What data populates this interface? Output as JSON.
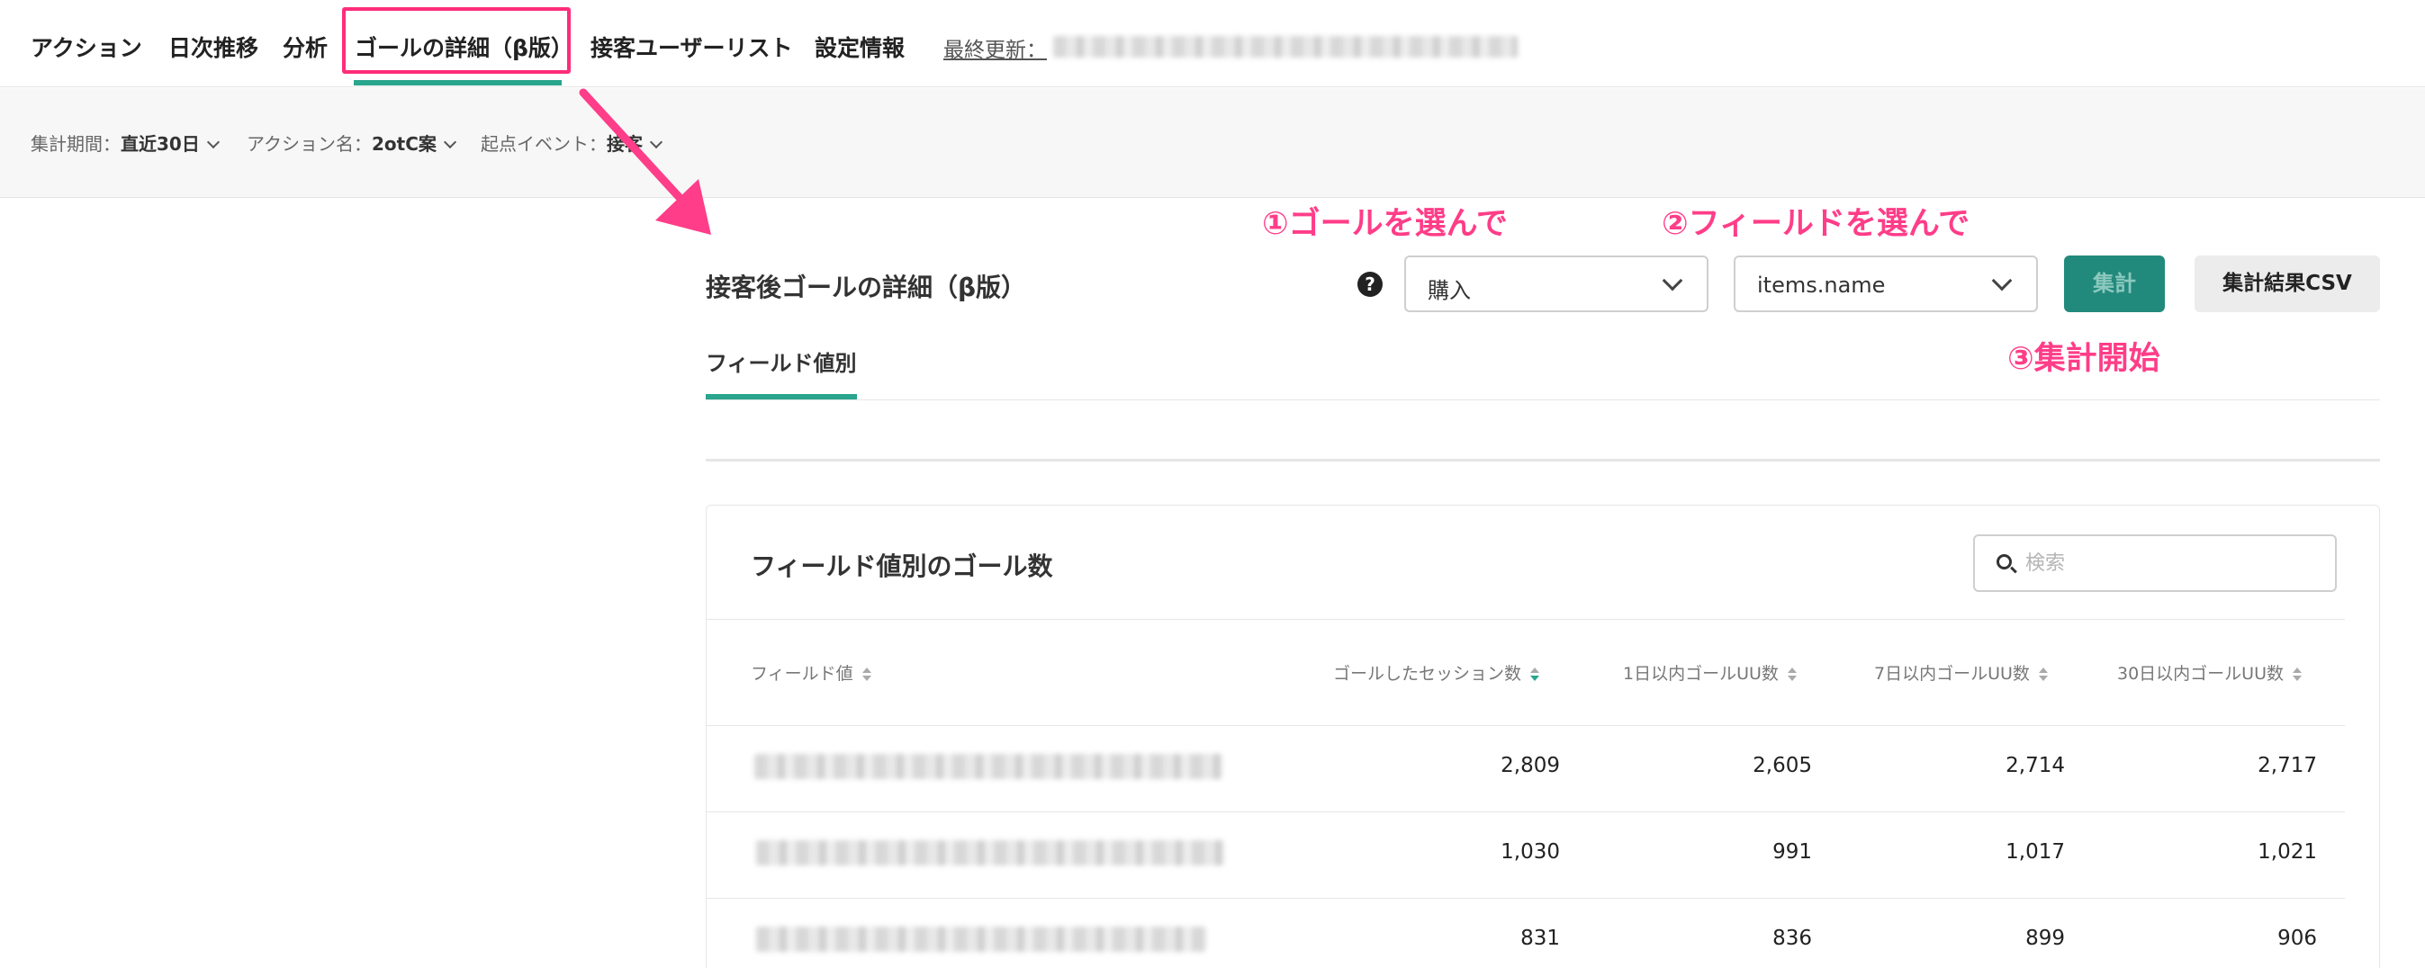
{
  "nav": {
    "items": [
      "アクション",
      "日次推移",
      "分析",
      "ゴールの詳細（β版）",
      "接客ユーザーリスト",
      "設定情報"
    ],
    "last_updated_label": "最終更新："
  },
  "filters": [
    {
      "label": "集計期間：",
      "value": "直近30日"
    },
    {
      "label": "アクション名：",
      "value": "2otC案"
    },
    {
      "label": "起点イベント：",
      "value": "接客"
    }
  ],
  "annotations": {
    "step1": "①ゴールを選んで",
    "step2": "②フィールドを選んで",
    "step3": "③集計開始"
  },
  "section": {
    "title": "接客後ゴールの詳細（β版）",
    "help_icon": "question-circle-icon",
    "goal_select_value": "購入",
    "field_select_value": "items.name",
    "aggregate_button": "集計",
    "csv_button": "集計結果CSV"
  },
  "tabs": [
    {
      "label": "フィールド値別",
      "active": true
    }
  ],
  "card": {
    "title": "フィールド値別のゴール数",
    "search_placeholder": "検索",
    "columns": [
      "フィールド値",
      "ゴールしたセッション数",
      "1日以内ゴールUU数",
      "7日以内ゴールUU数",
      "30日以内ゴールUU数"
    ],
    "rows": [
      {
        "sessions": "2,809",
        "uu1": "2,605",
        "uu7": "2,714",
        "uu30": "2,717"
      },
      {
        "sessions": "1,030",
        "uu1": "991",
        "uu7": "1,017",
        "uu30": "1,021"
      },
      {
        "sessions": "831",
        "uu1": "836",
        "uu7": "899",
        "uu30": "906"
      }
    ]
  },
  "colors": {
    "accent": "#2aa58e",
    "annotation": "#ff3d88",
    "primary_button": "#228a7c"
  }
}
